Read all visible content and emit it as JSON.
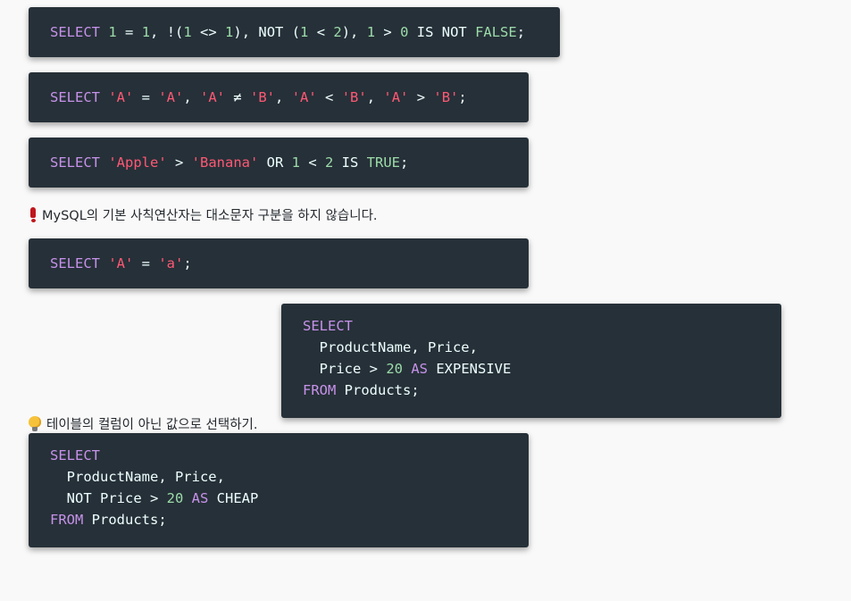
{
  "blocks": {
    "b1": {
      "select": "SELECT",
      "n1": "1",
      "eq": " = ",
      "n2": "1",
      "p1": ", !(",
      "n3": "1",
      "ne": " <> ",
      "n4": "1",
      "p2": "), NOT (",
      "n5": "1",
      "lt": " < ",
      "n6": "2",
      "p3": "), ",
      "n7": "1",
      "gt": " > ",
      "n8": "0",
      "isnot": " IS NOT ",
      "false": "FALSE",
      "semi": ";"
    },
    "b2": {
      "select": "SELECT",
      "s1": "'A'",
      "eq": " = ",
      "s2": "'A'",
      "c1": ", ",
      "s3": "'A'",
      "ne": " ≠ ",
      "s4": "'B'",
      "c2": ", ",
      "s5": "'A'",
      "lt": " < ",
      "s6": "'B'",
      "c3": ", ",
      "s7": "'A'",
      "gt": " > ",
      "s8": "'B'",
      "semi": ";"
    },
    "b3": {
      "select": "SELECT",
      "s1": "'Apple'",
      "gt": " > ",
      "s2": "'Banana'",
      "or": " OR ",
      "n1": "1",
      "lt": " < ",
      "n2": "2",
      "is": " IS ",
      "true": "TRUE",
      "semi": ";"
    },
    "b4": {
      "select": "SELECT",
      "s1": "'A'",
      "eq": " = ",
      "s2": "'a'",
      "semi": ";"
    },
    "b5": {
      "select": "SELECT",
      "line2": "  ProductName, Price,",
      "line3a": "  Price > ",
      "n1": "20",
      "as": " AS ",
      "alias": "EXPENSIVE",
      "from": "FROM",
      "table": " Products;"
    },
    "b6": {
      "select": "SELECT",
      "line2": "  ProductName, Price,",
      "line3a": "  NOT Price > ",
      "n1": "20",
      "as": " AS ",
      "alias": "CHEAP",
      "from": "FROM",
      "table": " Products;"
    }
  },
  "notes": {
    "case_note": "MySQL의 기본 사칙연산자는 대소문자 구분을 하지 않습니다.",
    "case_note_icon": "exclamation-icon",
    "tip_note": "테이블의 컬럼이 아닌 값으로 선택하기.",
    "tip_note_icon": "lightbulb-icon"
  },
  "colors": {
    "code_bg": "#263038",
    "keyword": "#c792ea",
    "number": "#9cdcaa",
    "string": "#ff5874",
    "text": "#eeffff"
  }
}
